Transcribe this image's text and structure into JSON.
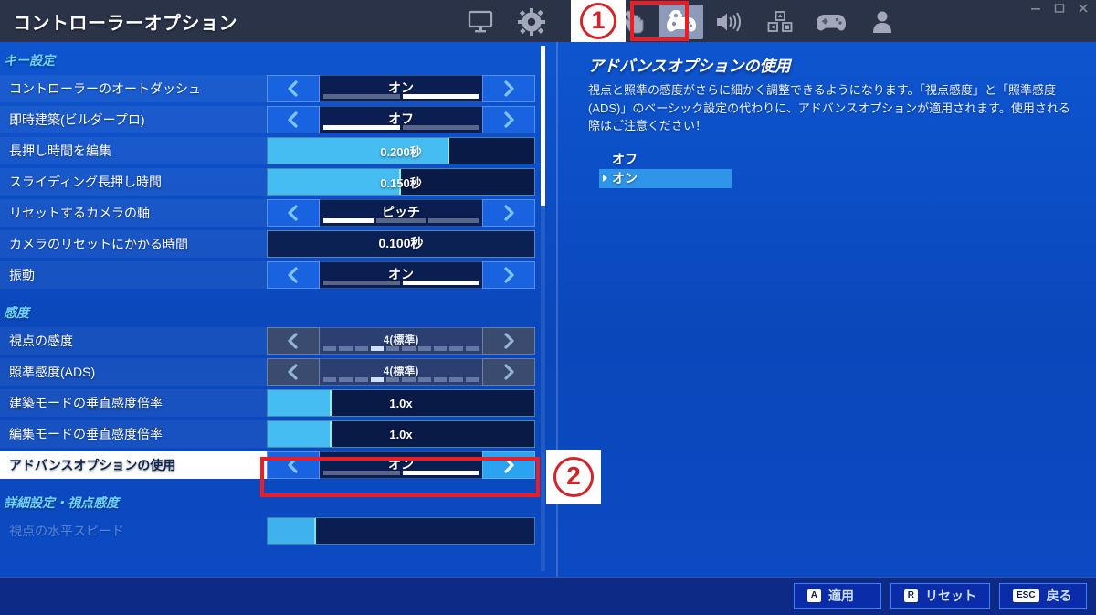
{
  "window": {
    "title": "コントローラーオプション",
    "controls": [
      "minimize-icon",
      "maximize-icon",
      "close-icon"
    ]
  },
  "header_icons": [
    {
      "name": "monitor-icon",
      "label": "ビデオ",
      "active": false
    },
    {
      "name": "gear-icon",
      "label": "ゲーム",
      "active": false
    },
    {
      "name": "hud-layout-icon",
      "label": "HUDレイアウト",
      "active": false
    },
    {
      "name": "touch-hand-icon",
      "label": "タッチ操作",
      "active": false
    },
    {
      "name": "controller-gear-icon",
      "label": "コントローラーオプション",
      "active": true
    },
    {
      "name": "speaker-icon",
      "label": "オーディオ",
      "active": false
    },
    {
      "name": "keybinds-icon",
      "label": "キー設定",
      "active": false
    },
    {
      "name": "gamepad-icon",
      "label": "コントローラー設定",
      "active": false
    },
    {
      "name": "account-icon",
      "label": "アカウント",
      "active": false
    }
  ],
  "annotations": [
    {
      "id": "1",
      "label": "1"
    },
    {
      "id": "2",
      "label": "2"
    }
  ],
  "left_panel": {
    "sections": [
      {
        "title": "キー設定",
        "rows": [
          {
            "label": "コントローラーのオートダッシュ",
            "value": "オン",
            "type": "arrows",
            "segments": 2,
            "active_segment": 2,
            "disabled": false
          },
          {
            "label": "即時建築(ビルダープロ)",
            "value": "オフ",
            "type": "arrows",
            "segments": 2,
            "active_segment": 1,
            "disabled": false
          },
          {
            "label": "長押し時間を編集",
            "value": "0.200秒",
            "type": "slider",
            "fill_percent": 68,
            "disabled": false
          },
          {
            "label": "スライディング長押し時間",
            "value": "0.150秒",
            "type": "slider",
            "fill_percent": 50,
            "disabled": false
          },
          {
            "label": "リセットするカメラの軸",
            "value": "ピッチ",
            "type": "arrows",
            "segments": 3,
            "active_segment": 1,
            "disabled": false
          },
          {
            "label": "カメラのリセットにかかる時間",
            "value": "0.100秒",
            "type": "plain",
            "disabled": false
          },
          {
            "label": "振動",
            "value": "オン",
            "type": "arrows",
            "segments": 2,
            "active_segment": 2,
            "disabled": false
          }
        ]
      },
      {
        "title": "感度",
        "rows": [
          {
            "label": "視点の感度",
            "value": "4(標準)",
            "type": "arrows",
            "segments": 10,
            "active_segment": 4,
            "disabled": true
          },
          {
            "label": "照準感度(ADS)",
            "value": "4(標準)",
            "type": "arrows",
            "segments": 10,
            "active_segment": 4,
            "disabled": true
          },
          {
            "label": "建築モードの垂直感度倍率",
            "value": "1.0x",
            "type": "slider",
            "fill_percent": 24,
            "disabled": false
          },
          {
            "label": "編集モードの垂直感度倍率",
            "value": "1.0x",
            "type": "slider",
            "fill_percent": 24,
            "disabled": false
          },
          {
            "label": "アドバンスオプションの使用",
            "value": "オン",
            "type": "arrows",
            "segments": 2,
            "active_segment": 2,
            "disabled": false,
            "selected": true,
            "highlight_right_arrow": true,
            "boxed": true
          }
        ]
      },
      {
        "title": "詳細設定・視点感度",
        "rows": [
          {
            "label": "視点の水平スピード",
            "value": "",
            "type": "slider",
            "fill_percent": 18,
            "disabled": false,
            "cut_off": true
          }
        ]
      }
    ]
  },
  "right_panel": {
    "title": "アドバンスオプションの使用",
    "description": "視点と照準の感度がさらに細かく調整できるようになります。「視点感度」と「照準感度(ADS)」のベーシック設定の代わりに、アドバンスオプションが適用されます。使用される際はご注意ください！",
    "options": [
      {
        "label": "オフ",
        "selected": false
      },
      {
        "label": "オン",
        "selected": true
      }
    ]
  },
  "footer": {
    "buttons": [
      {
        "key": "A",
        "label": "適用",
        "name": "apply-button"
      },
      {
        "key": "R",
        "label": "リセット",
        "name": "reset-button"
      },
      {
        "key": "ESC",
        "label": "戻る",
        "name": "back-button"
      }
    ]
  },
  "colors": {
    "accent_blue": "#0b4bc4",
    "titlebar": "#2b3348",
    "highlight_red": "#ef1c24",
    "slider_cyan": "#45bdf2",
    "section_title": "#6fd4ff"
  }
}
